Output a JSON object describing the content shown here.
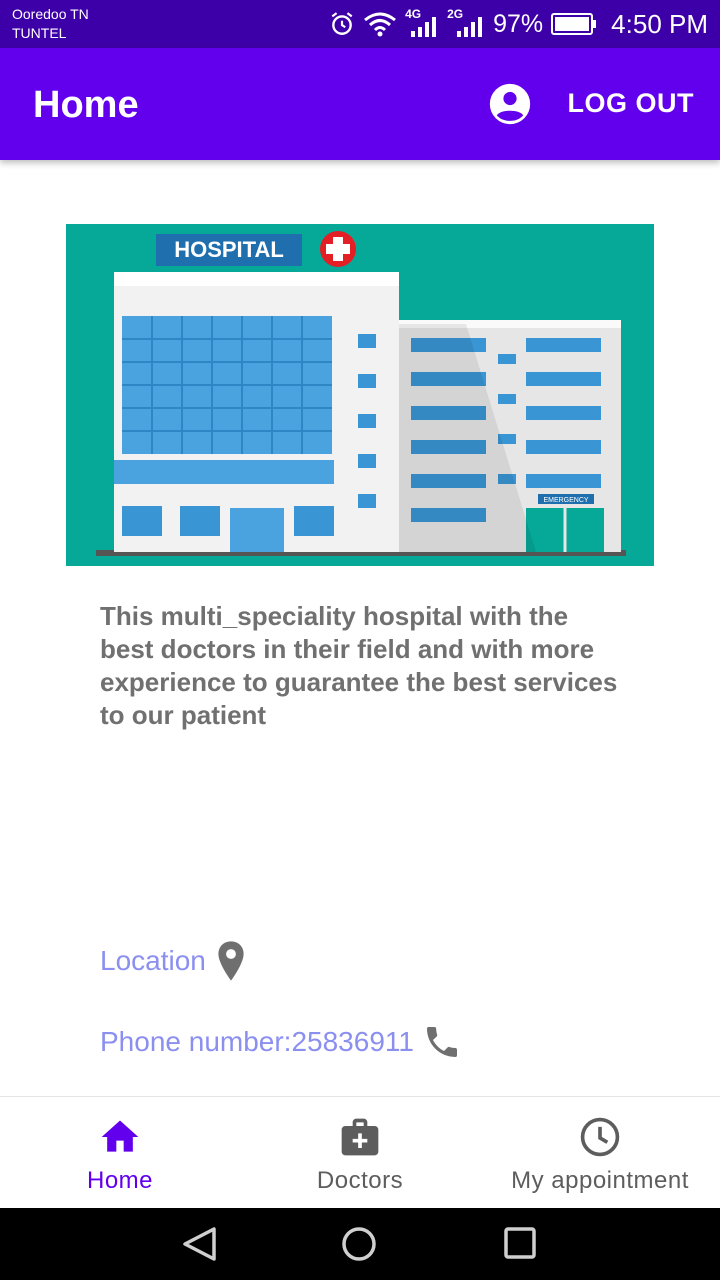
{
  "status_bar": {
    "carrier_line1": "Ooredoo TN",
    "carrier_line2": "TUNTEL",
    "network_4g": "4G",
    "network_2g": "2G",
    "battery": "97%",
    "time": "4:50 PM"
  },
  "app_bar": {
    "title": "Home",
    "logout_label": "LOG OUT"
  },
  "hero": {
    "sign_text": "HOSPITAL",
    "emergency_text": "EMERGENCY"
  },
  "content": {
    "description": "This multi_speciality hospital with the best doctors in their field and with more experience to guarantee the best services to our patient",
    "location_label": "Location",
    "phone_label": "Phone number:25836911"
  },
  "bottom_nav": {
    "items": [
      {
        "label": "Home",
        "icon": "home-icon",
        "active": true
      },
      {
        "label": "Doctors",
        "icon": "medical-bag-icon",
        "active": false
      },
      {
        "label": "My appointment",
        "icon": "clock-icon",
        "active": false
      }
    ]
  },
  "colors": {
    "primary": "#6200ee",
    "status_bar": "#3d00a8",
    "info_text": "#8b8ff0",
    "description_text": "#707070"
  }
}
